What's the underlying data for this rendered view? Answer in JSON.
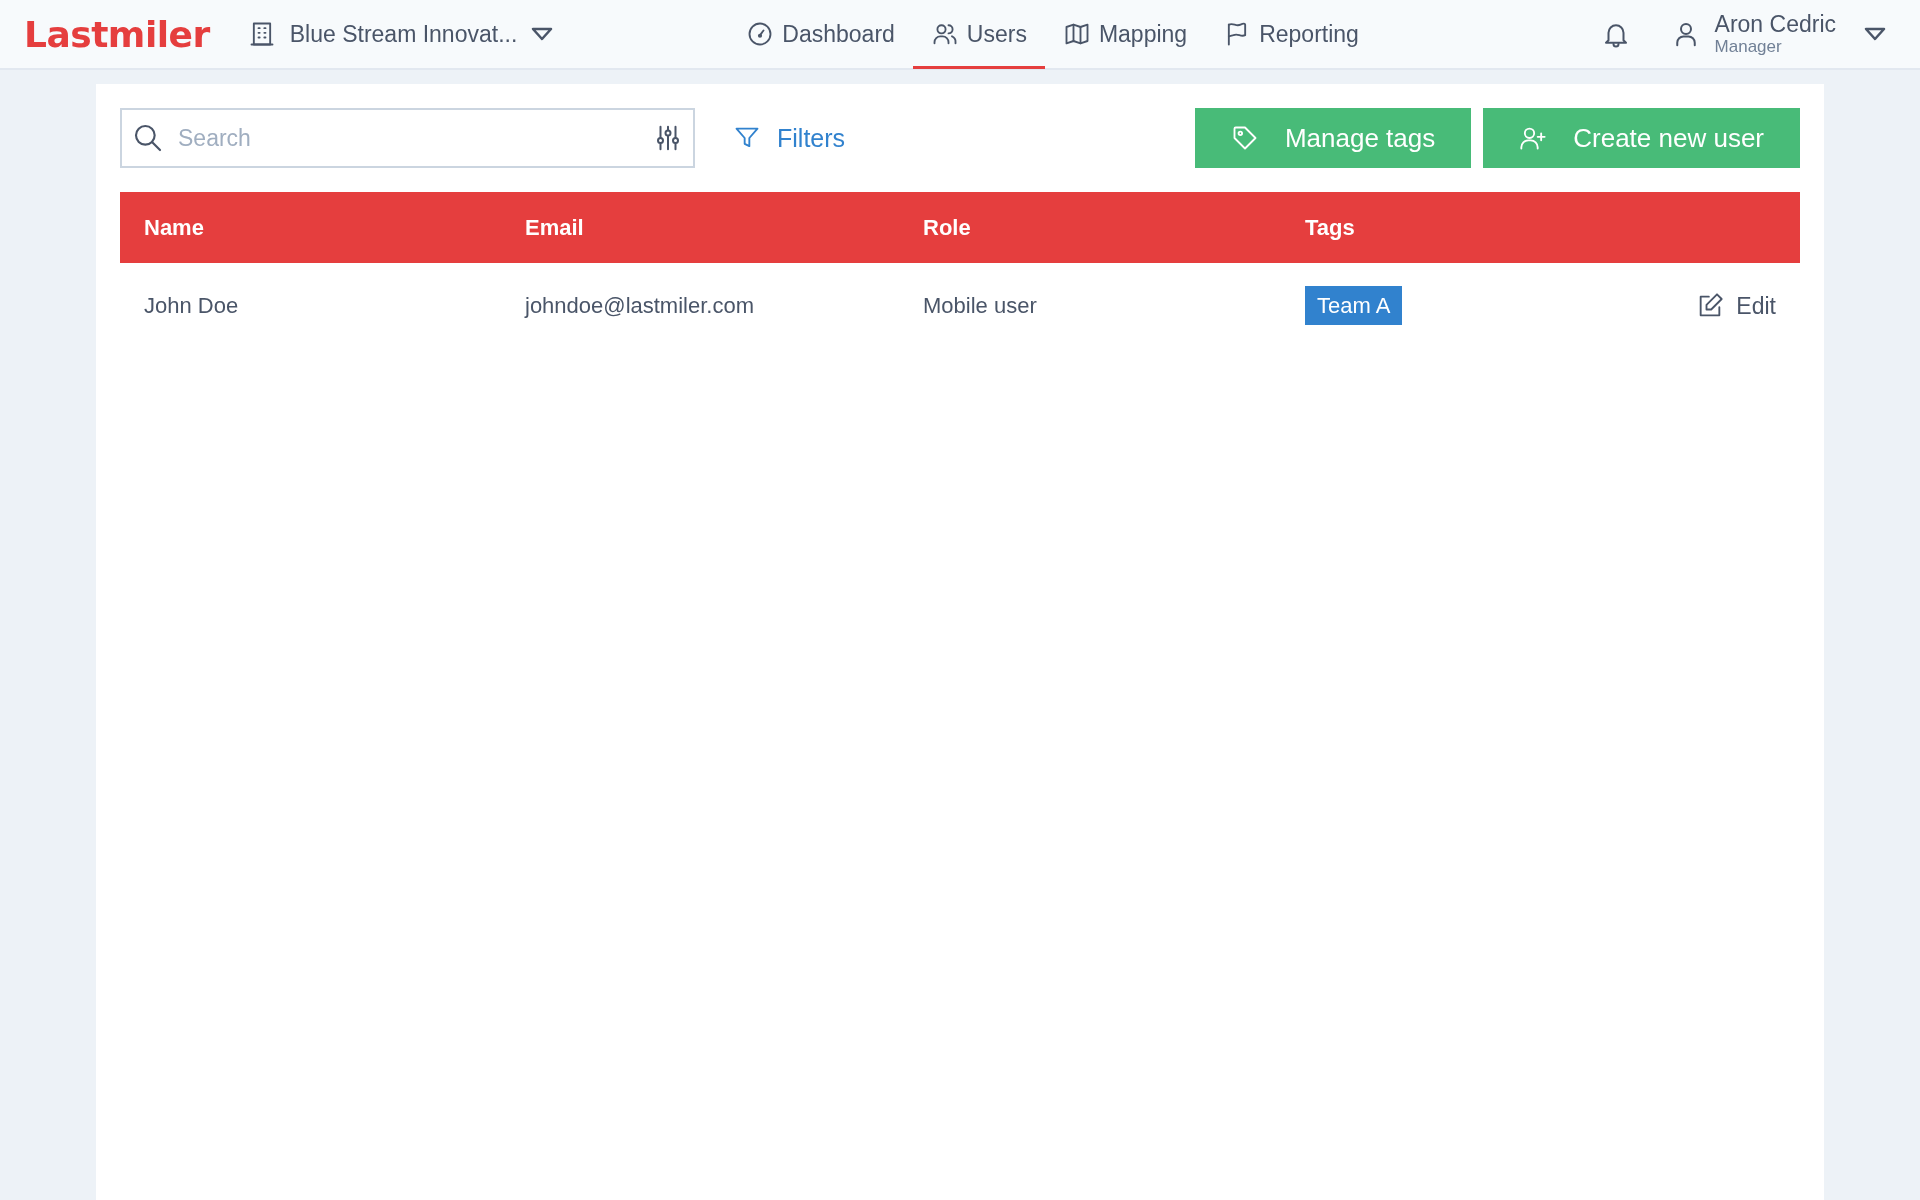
{
  "header": {
    "logo": "Lastmiler",
    "organization": "Blue Stream Innovat...",
    "nav": [
      {
        "label": "Dashboard",
        "kind": "gauge",
        "selected": false
      },
      {
        "label": "Users",
        "kind": "users",
        "selected": true
      },
      {
        "label": "Mapping",
        "kind": "map",
        "selected": false
      },
      {
        "label": "Reporting",
        "kind": "flag",
        "selected": false
      }
    ],
    "user": {
      "name": "Aron Cedric",
      "role": "Manager"
    }
  },
  "toolbar": {
    "search": {
      "placeholder": "Search"
    },
    "filters": "Filters",
    "buttons": [
      {
        "label": "Manage tags",
        "kind": "tag"
      },
      {
        "label": "Create new user",
        "kind": "user-plus"
      }
    ]
  },
  "table": {
    "columns": [
      "Name",
      "Email",
      "Role",
      "Tags"
    ],
    "rows": [
      {
        "name": "John Doe",
        "email": "johndoe@lastmiler.com",
        "role": "Mobile user",
        "tags": [
          "Team A"
        ],
        "action": "Edit"
      }
    ]
  }
}
